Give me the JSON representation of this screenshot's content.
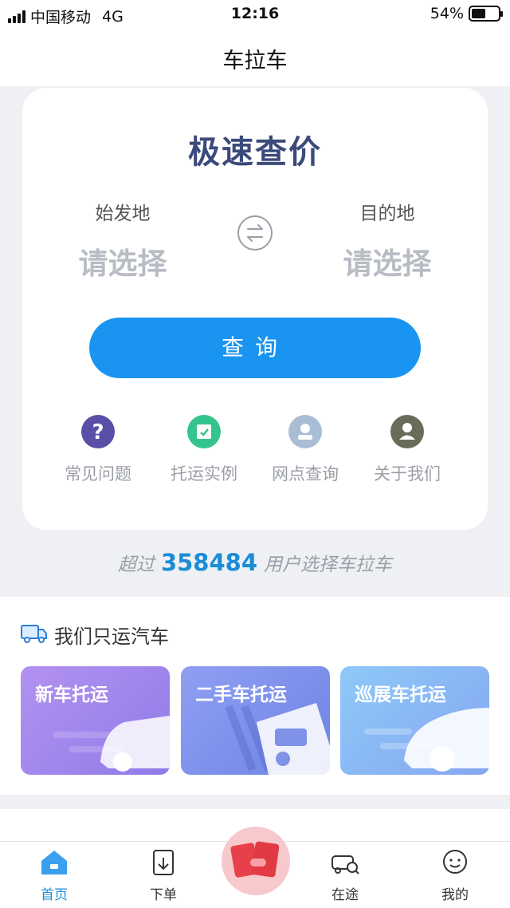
{
  "status_bar": {
    "carrier": "中国移动",
    "network": "4G",
    "time": "12:16",
    "battery_percent": "54%",
    "battery_level": 0.54
  },
  "nav": {
    "title": "车拉车"
  },
  "hero": {
    "title": "极速查价",
    "origin_label": "始发地",
    "origin_value": "请选择",
    "dest_label": "目的地",
    "dest_value": "请选择",
    "query_button": "查询",
    "swap_icon": "swap-arrows-icon",
    "quick_links": [
      {
        "label": "常见问题",
        "icon": "question-icon",
        "color": "#5a4fa8"
      },
      {
        "label": "托运实例",
        "icon": "shield-check-icon",
        "color": "#34c58f"
      },
      {
        "label": "网点查询",
        "icon": "outlet-icon",
        "color": "#a9bdd4"
      },
      {
        "label": "关于我们",
        "icon": "person-icon",
        "color": "#6b6b5a"
      }
    ]
  },
  "user_count": {
    "prefix": "超过",
    "number": "358484",
    "suffix": "用户选择车拉车"
  },
  "services": {
    "title": "我们只运汽车",
    "icon": "truck-icon",
    "cards": [
      {
        "label": "新车托运"
      },
      {
        "label": "二手车托运"
      },
      {
        "label": "巡展车托运"
      }
    ]
  },
  "tabs": [
    {
      "label": "首页",
      "icon": "home-icon",
      "active": true
    },
    {
      "label": "下单",
      "icon": "order-icon",
      "active": false
    },
    {
      "label": "在途",
      "icon": "car-search-icon",
      "active": false
    },
    {
      "label": "我的",
      "icon": "face-icon",
      "active": false
    }
  ],
  "red_packet_icon": "red-packet-icon",
  "colors": {
    "accent": "#1a94f1",
    "title": "#3b4a7a",
    "placeholder": "#b8bcc4"
  }
}
